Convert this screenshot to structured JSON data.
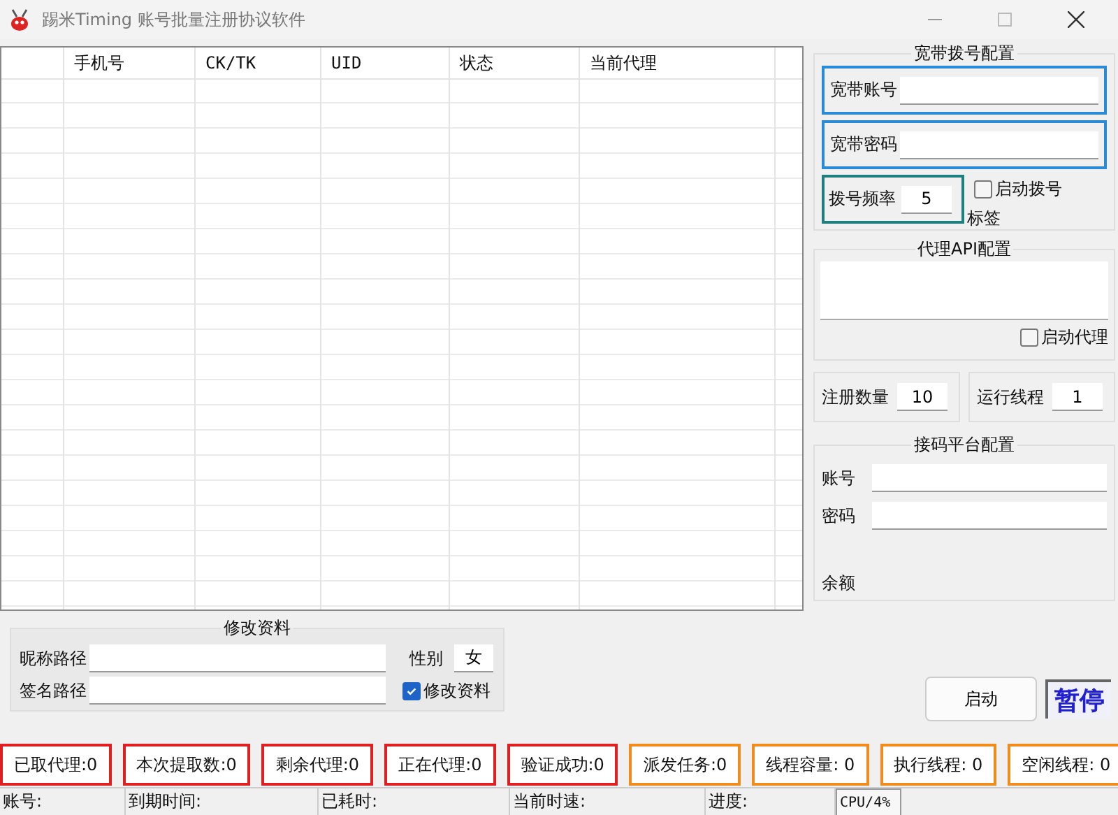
{
  "window": {
    "title": "踢米Timing 账号批量注册协议软件"
  },
  "table": {
    "columns": [
      {
        "label": "手机号"
      },
      {
        "label": "CK/TK"
      },
      {
        "label": "UID"
      },
      {
        "label": "状态"
      },
      {
        "label": "当前代理"
      }
    ]
  },
  "dial_config": {
    "title": "宽带拨号配置",
    "account_label": "宽带账号",
    "password_label": "宽带密码",
    "frequency_label": "拨号频率",
    "frequency_value": "5",
    "auto_dial": {
      "label": "启动拨号",
      "checked": false
    },
    "tag_label": "标签"
  },
  "proxy_api": {
    "title": "代理API配置",
    "auto_proxy": {
      "label": "启动代理",
      "checked": false
    }
  },
  "counts": [
    {
      "label": "注册数量",
      "value": "10"
    },
    {
      "label": "运行线程",
      "value": "1"
    }
  ],
  "sms_platform": {
    "title": "接码平台配置",
    "account_label": "账号",
    "password_label": "密码",
    "balance_label": "余额"
  },
  "profile": {
    "title": "修改资料",
    "nickname_label": "昵称路径",
    "signature_label": "签名路径",
    "gender_label": "性别",
    "gender_value": "女",
    "modify": {
      "label": "修改资料",
      "checked": true
    }
  },
  "buttons": [
    {
      "label": "启动",
      "kind": "normal"
    },
    {
      "label": "暂停",
      "kind": "sunken"
    }
  ],
  "stats": [
    {
      "label": "已取代理:0",
      "color": "#e02020"
    },
    {
      "label": "本次提取数:0",
      "color": "#e02020"
    },
    {
      "label": "剩余代理:0",
      "color": "#e02020"
    },
    {
      "label": "正在代理:0",
      "color": "#e02020"
    },
    {
      "label": "验证成功:0",
      "color": "#e02020"
    },
    {
      "label": "派发任务:0",
      "color": "#f08c1e"
    },
    {
      "label": "线程容量: 0",
      "color": "#f08c1e"
    },
    {
      "label": "执行线程: 0",
      "color": "#f08c1e"
    },
    {
      "label": "空闲线程: 0",
      "color": "#f08c1e"
    }
  ],
  "status_bar": [
    {
      "text": "账号:",
      "kind": "plain"
    },
    {
      "text": "到期时间:",
      "kind": "plain"
    },
    {
      "text": "已耗时:",
      "kind": "plain"
    },
    {
      "text": "当前时速:",
      "kind": "plain"
    },
    {
      "text": "进度:",
      "kind": "plain"
    },
    {
      "text": "CPU/4%",
      "kind": "sunken"
    }
  ]
}
